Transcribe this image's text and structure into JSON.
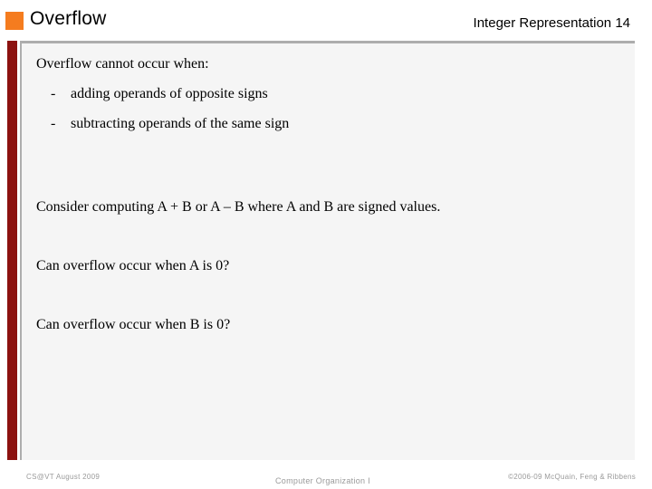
{
  "header": {
    "title": "Overflow",
    "subtitle": "Integer Representation 14",
    "bullet_square_color": "#F57C1F"
  },
  "accent": {
    "bar_color": "#8C1210",
    "panel_background": "#F5F5F5",
    "panel_border_color": "#ADADAD"
  },
  "body": {
    "intro": "Overflow cannot occur when:",
    "bullets": [
      {
        "marker": "-",
        "text": "adding operands of opposite signs"
      },
      {
        "marker": "-",
        "text": "subtracting operands of the same sign"
      }
    ],
    "consider": "Consider computing A + B or A – B where A and B are signed values.",
    "question_a": "Can overflow occur when A is 0?",
    "question_b": "Can overflow occur when B is 0?"
  },
  "footer": {
    "left": "CS@VT August 2009",
    "center": "Computer Organization I",
    "right": "©2006-09  McQuain, Feng & Ribbens"
  }
}
